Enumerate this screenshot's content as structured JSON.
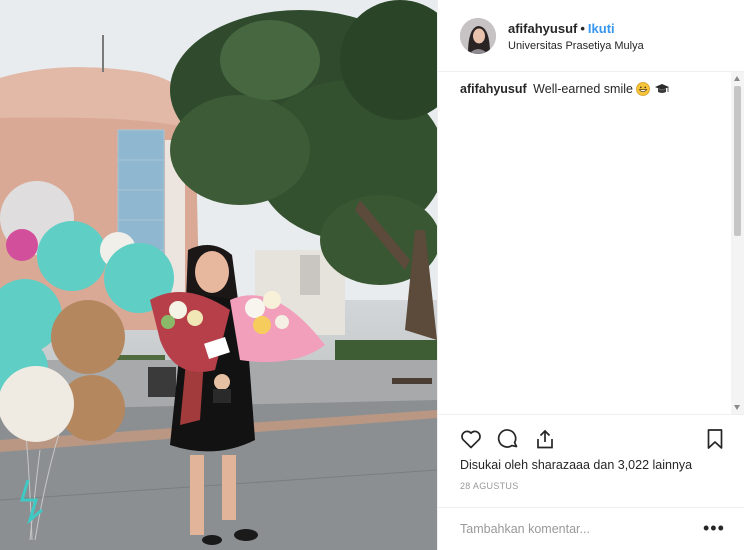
{
  "post": {
    "username": "afifahyusuf",
    "separator": "•",
    "follow_label": "Ikuti",
    "location": "Universitas Prasetiya Mulya",
    "caption_text": "Well-earned smile",
    "caption_emojis": [
      "grinning-face-icon",
      "graduation-cap-icon"
    ],
    "likes_text": "Disukai oleh sharazaaa dan 3,022 lainnya",
    "date": "28 AGUSTUS",
    "comment_placeholder": "Tambahkan komentar...",
    "more_label": "•••"
  },
  "colors": {
    "follow_blue": "#3897f0",
    "border": "#efefef",
    "muted_text": "#999999"
  }
}
